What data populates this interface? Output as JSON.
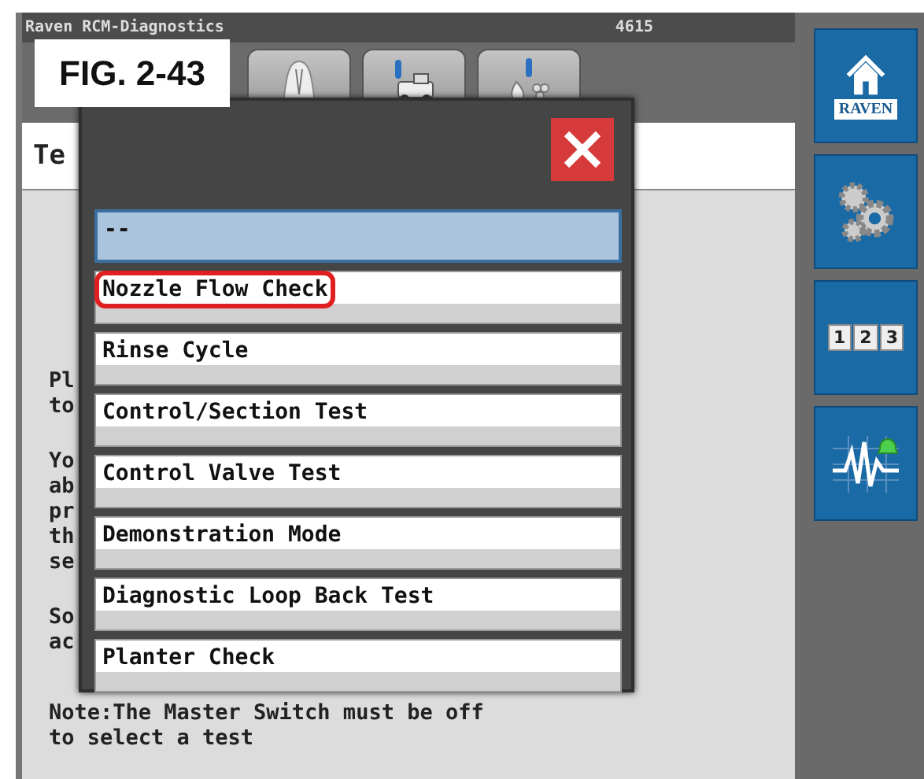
{
  "window": {
    "title": "Raven RCM-Diagnostics",
    "code": "4615"
  },
  "figure_label": "FIG. 2-43",
  "page": {
    "heading": "Te",
    "paragraphs": [
      [
        "Pl",
        "to"
      ],
      [
        "Yo",
        "ab",
        "pr",
        "th",
        "se"
      ],
      [
        "So",
        "ac"
      ],
      [
        "Note:The Master Switch must be off",
        "to select a test"
      ]
    ]
  },
  "test_dialog": {
    "items": [
      {
        "label": "--",
        "selected": true,
        "highlighted": false
      },
      {
        "label": "Nozzle Flow Check",
        "selected": false,
        "highlighted": true
      },
      {
        "label": "Rinse Cycle",
        "selected": false,
        "highlighted": false
      },
      {
        "label": "Control/Section Test",
        "selected": false,
        "highlighted": false
      },
      {
        "label": "Control Valve Test",
        "selected": false,
        "highlighted": false
      },
      {
        "label": "Demonstration Mode",
        "selected": false,
        "highlighted": false
      },
      {
        "label": "Diagnostic Loop Back Test",
        "selected": false,
        "highlighted": false
      },
      {
        "label": "Planter Check",
        "selected": false,
        "highlighted": false
      }
    ]
  },
  "sidebar": [
    {
      "kind": "home",
      "label": "RAVEN"
    },
    {
      "kind": "settings"
    },
    {
      "kind": "keypad",
      "digits": [
        "1",
        "2",
        "3"
      ]
    },
    {
      "kind": "diagnostics"
    }
  ]
}
